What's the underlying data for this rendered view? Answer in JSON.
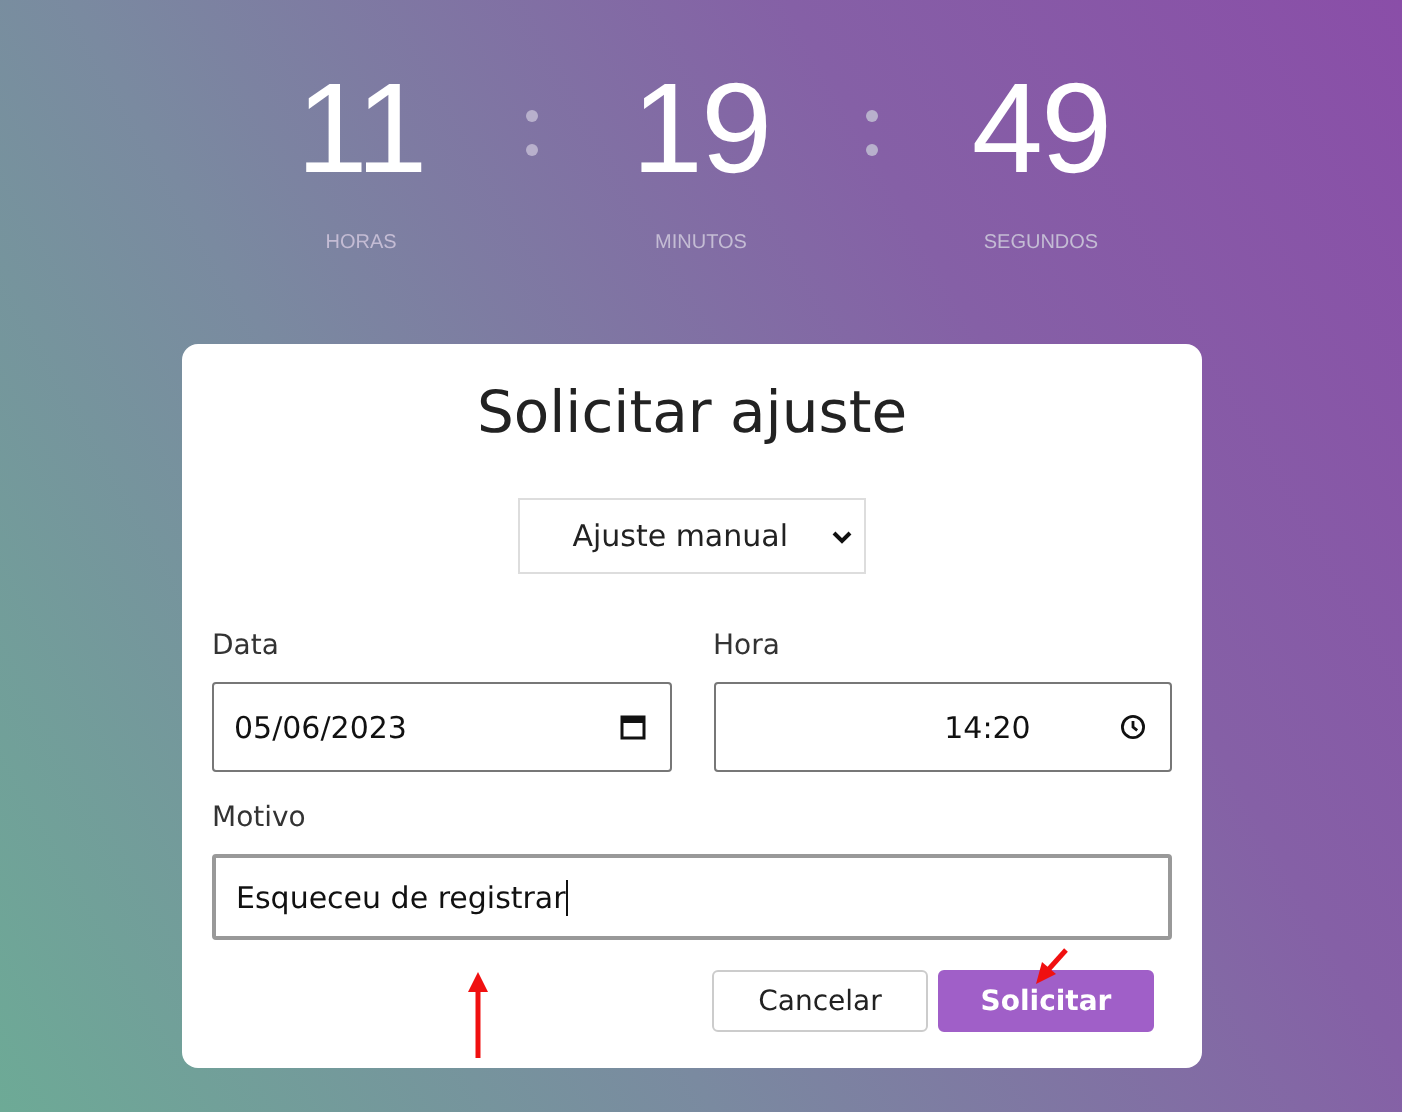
{
  "timer": [
    {
      "value": "11",
      "label": "HORAS"
    },
    {
      "value": "19",
      "label": "MINUTOS"
    },
    {
      "value": "49",
      "label": "SEGUNDOS"
    }
  ],
  "dialog": {
    "title": "Solicitar ajuste",
    "adjust_type": {
      "value": "Ajuste manual"
    },
    "date": {
      "label": "Data",
      "value": "05/06/2023"
    },
    "time": {
      "label": "Hora",
      "value": "14:20"
    },
    "reason": {
      "label": "Motivo",
      "value": "Esqueceu de registrar",
      "focused": true
    },
    "buttons": [
      {
        "label": "Cancelar",
        "kind": "secondary"
      },
      {
        "label": "Solicitar",
        "kind": "primary"
      }
    ]
  }
}
